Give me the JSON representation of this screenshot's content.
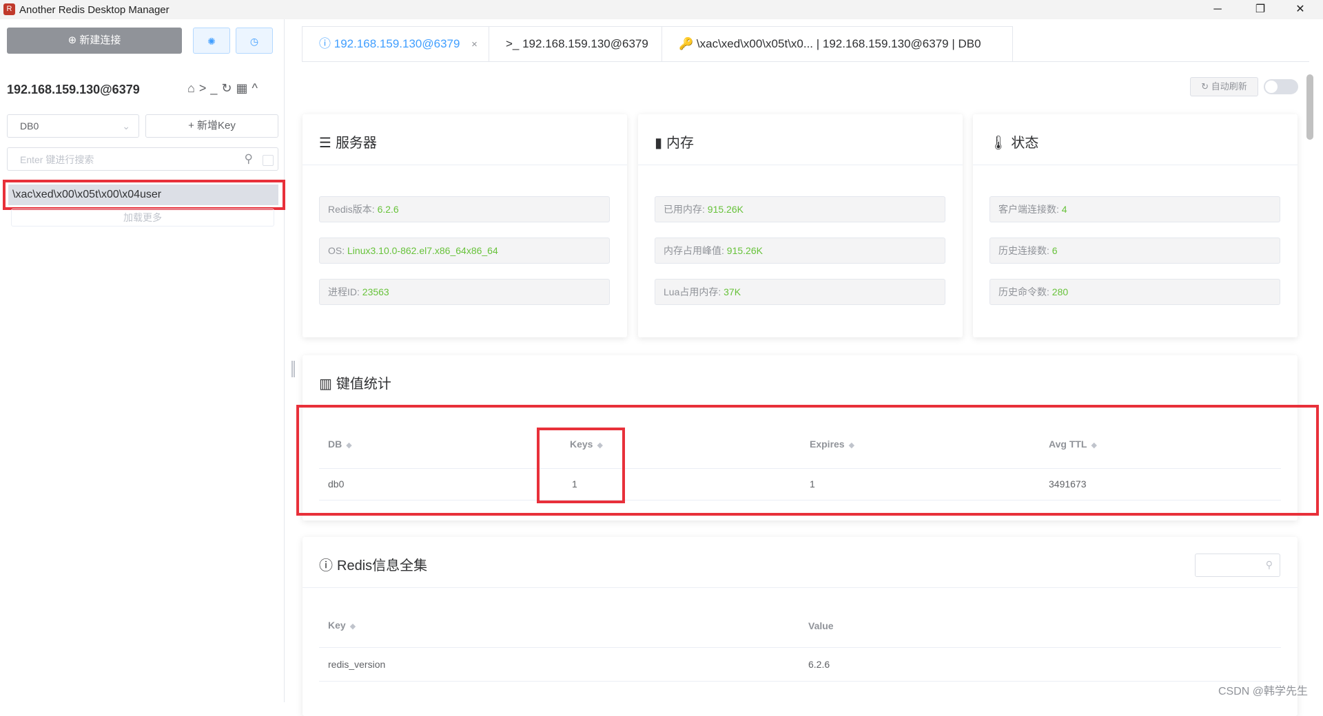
{
  "window": {
    "title": "Another Redis Desktop Manager",
    "minimize": "─",
    "maximize": "❐",
    "close": "✕"
  },
  "sidebar": {
    "new_connection": "新建连接",
    "settings_icon": "✺",
    "history_icon": "◷",
    "connection_name": "192.168.159.130@6379",
    "db_select": "DB0",
    "add_key": "+ 新增Key",
    "search_placeholder": "Enter 键进行搜索",
    "keys": [
      "\\xac\\xed\\x00\\x05t\\x00\\x04user"
    ],
    "load_more": "加载更多"
  },
  "tabs": [
    {
      "label": "192.168.159.130@6379",
      "icon": "info-icon",
      "close": "×"
    },
    {
      "label": ">_ 192.168.159.130@6379",
      "icon": "terminal-icon"
    },
    {
      "label": "🔑 \\xac\\xed\\x00\\x05t\\x0... | 192.168.159.130@6379 | DB0",
      "icon": "key-icon"
    }
  ],
  "toolbar": {
    "auto_refresh": "自动刷新",
    "auto_refresh_on": false
  },
  "server_card": {
    "title": "服务器",
    "rows": [
      {
        "label": "Redis版本: ",
        "value": "6.2.6"
      },
      {
        "label": "OS: ",
        "value": "Linux3.10.0-862.el7.x86_64x86_64"
      },
      {
        "label": "进程ID: ",
        "value": "23563"
      }
    ]
  },
  "memory_card": {
    "title": "内存",
    "rows": [
      {
        "label": "已用内存: ",
        "value": "915.26K"
      },
      {
        "label": "内存占用峰值: ",
        "value": "915.26K"
      },
      {
        "label": "Lua占用内存: ",
        "value": "37K"
      }
    ]
  },
  "status_card": {
    "title": "状态",
    "rows": [
      {
        "label": "客户端连接数: ",
        "value": "4"
      },
      {
        "label": "历史连接数: ",
        "value": "6"
      },
      {
        "label": "历史命令数: ",
        "value": "280"
      }
    ]
  },
  "key_stats": {
    "title": "键值统计",
    "columns": [
      "DB",
      "Keys",
      "Expires",
      "Avg TTL"
    ],
    "rows": [
      [
        "db0",
        "1",
        "1",
        "3491673"
      ]
    ]
  },
  "redis_info": {
    "title": "Redis信息全集",
    "columns": [
      "Key",
      "Value"
    ],
    "rows": [
      [
        "redis_version",
        "6.2.6"
      ]
    ]
  },
  "watermark": "CSDN @韩学先生",
  "colors": {
    "accent": "#409eff",
    "value_green": "#67c23a",
    "highlight_red": "#e8303a"
  }
}
